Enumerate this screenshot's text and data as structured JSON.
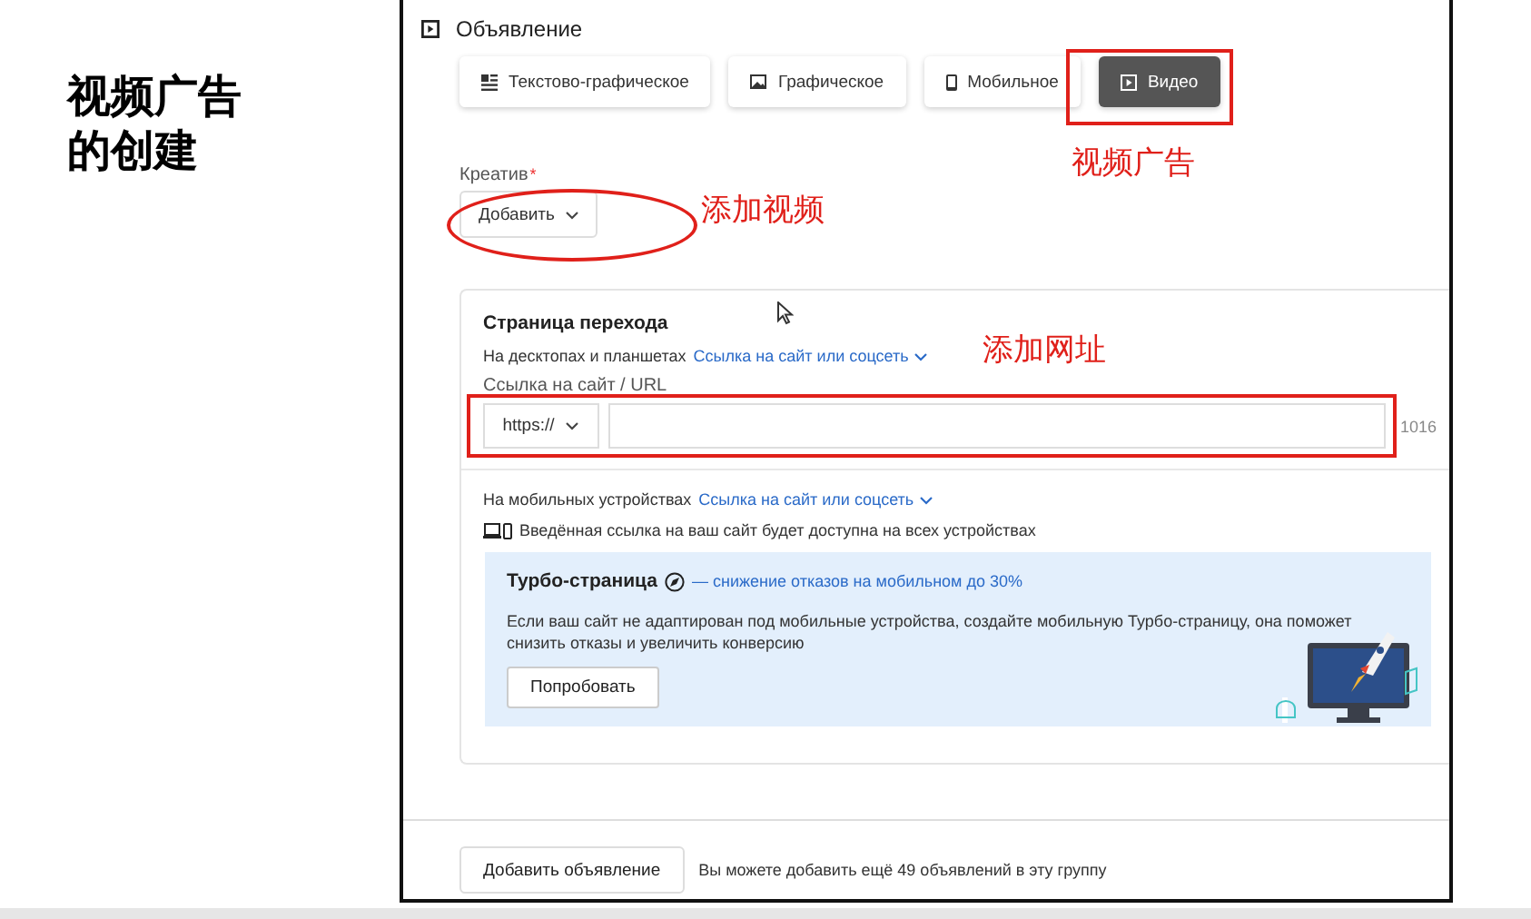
{
  "slide_title": [
    "视频广告",
    "的创建"
  ],
  "ad_section": {
    "title": "Объявление",
    "ad_types": [
      {
        "label": "Текстово-графическое",
        "kind": "textimage",
        "selected": false
      },
      {
        "label": "Графическое",
        "kind": "image",
        "selected": false
      },
      {
        "label": "Мобильное",
        "kind": "phone",
        "selected": false
      },
      {
        "label": "Видео",
        "kind": "video",
        "selected": true
      }
    ],
    "creative": {
      "label": "Креатив",
      "required_mark": "*",
      "button": "Добавить"
    },
    "landing_page": {
      "title": "Страница перехода",
      "desktop_label": "На десктопах и планшетах",
      "desktop_link": "Ссылка на сайт или соцсеть",
      "url_label": "Ссылка на сайт / URL",
      "protocol": "https://",
      "counter": "1016",
      "mobile_label": "На мобильных устройствах",
      "mobile_link": "Ссылка на сайт или соцсеть",
      "devices_note": "Введённая ссылка на ваш сайт будет доступна на всех устройствах",
      "turbo": {
        "title": "Турбо-страница",
        "subtitle": "— снижение отказов на мобильном до 30%",
        "text": "Если ваш сайт не адаптирован под мобильные устройства, создайте мобильную Турбо-страницу, она поможет снизить отказы и увеличить конверсию",
        "button": "Попробовать"
      }
    },
    "footer": {
      "button": "Добавить объявление",
      "note": "Вы можете добавить ещё 49 объявлений в эту группу"
    }
  },
  "annotations": [
    {
      "kind": "rect",
      "text": "视频广告"
    },
    {
      "kind": "ellipse",
      "text": "添加视频"
    },
    {
      "kind": "rect",
      "text": "添加网址"
    }
  ]
}
